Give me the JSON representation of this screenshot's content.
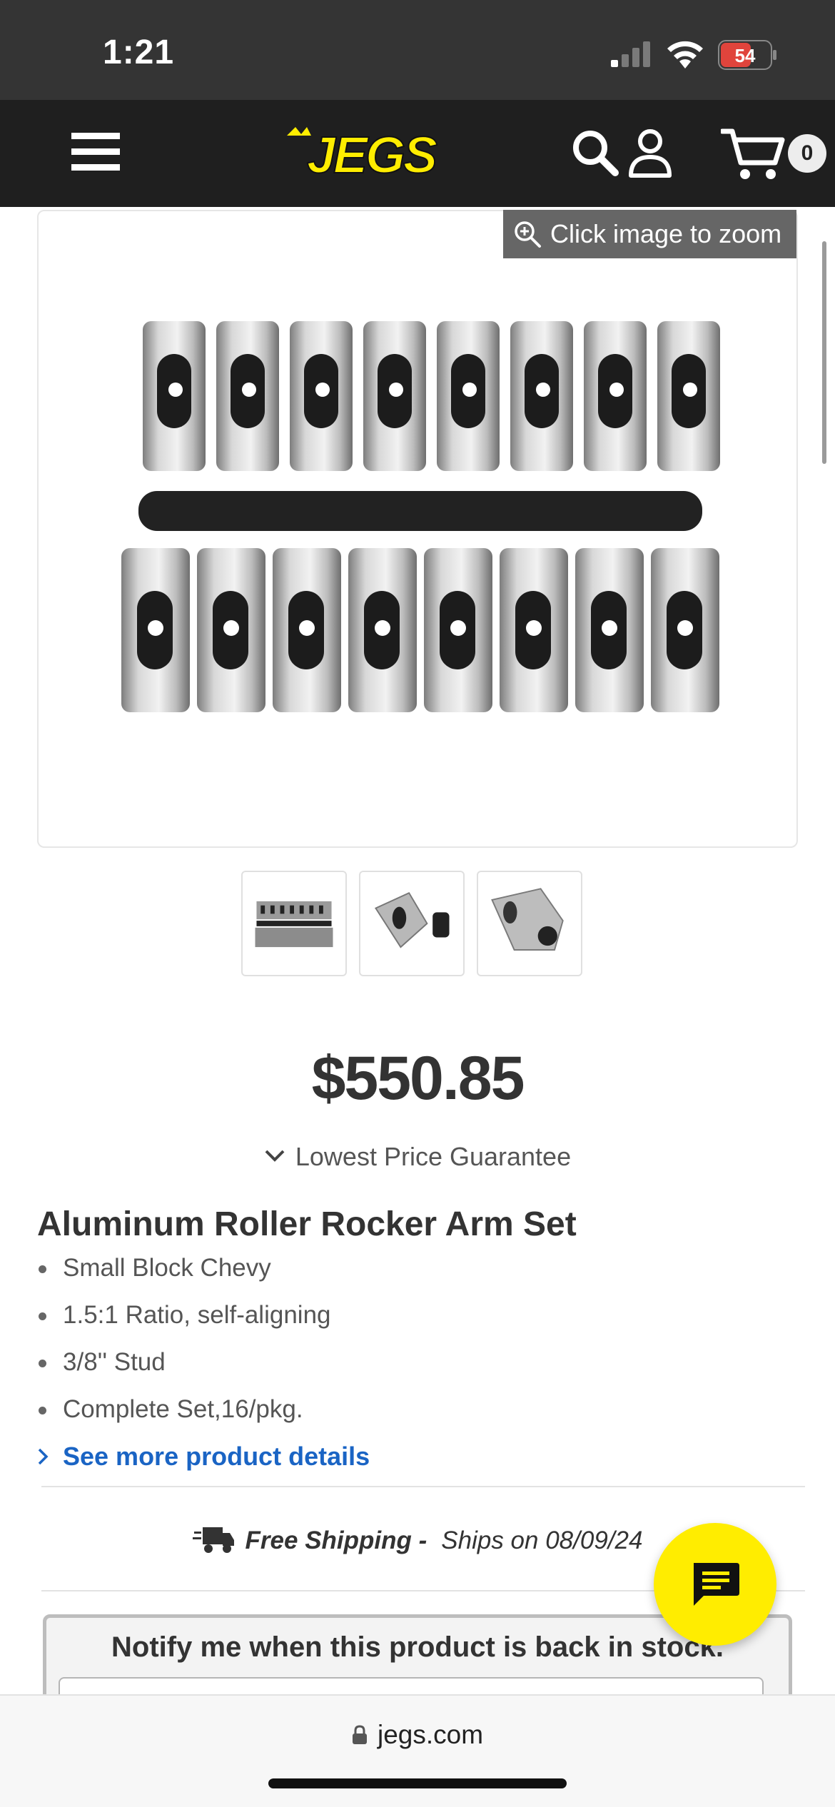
{
  "status_bar": {
    "time": "1:21",
    "battery_level": "54"
  },
  "header": {
    "logo_text": "JEGS",
    "cart_count": "0",
    "icons": {
      "menu": "hamburger-menu-icon",
      "search": "search-icon",
      "account": "account-icon",
      "cart": "cart-icon"
    },
    "colors": {
      "background": "#1f1f1f",
      "logo_yellow": "#ffed00"
    }
  },
  "gallery": {
    "zoom_hint": "Click image to zoom",
    "thumbnail_count": 3
  },
  "product": {
    "price": "$550.85",
    "price_guarantee": "Lowest Price Guarantee",
    "title": "Aluminum Roller Rocker Arm Set",
    "bullets": [
      "Small Block Chevy",
      "1.5:1 Ratio, self-aligning",
      "3/8'' Stud",
      "Complete Set,16/pkg."
    ],
    "more_details_link": "See more product details"
  },
  "shipping": {
    "label": "Free Shipping -",
    "ships_on": "Ships on 08/09/24"
  },
  "notify": {
    "title": "Notify me when this product is back in stock."
  },
  "browser": {
    "url": "jegs.com"
  },
  "colors": {
    "link_blue": "#1a64c4",
    "chat_yellow": "#ffed00"
  }
}
